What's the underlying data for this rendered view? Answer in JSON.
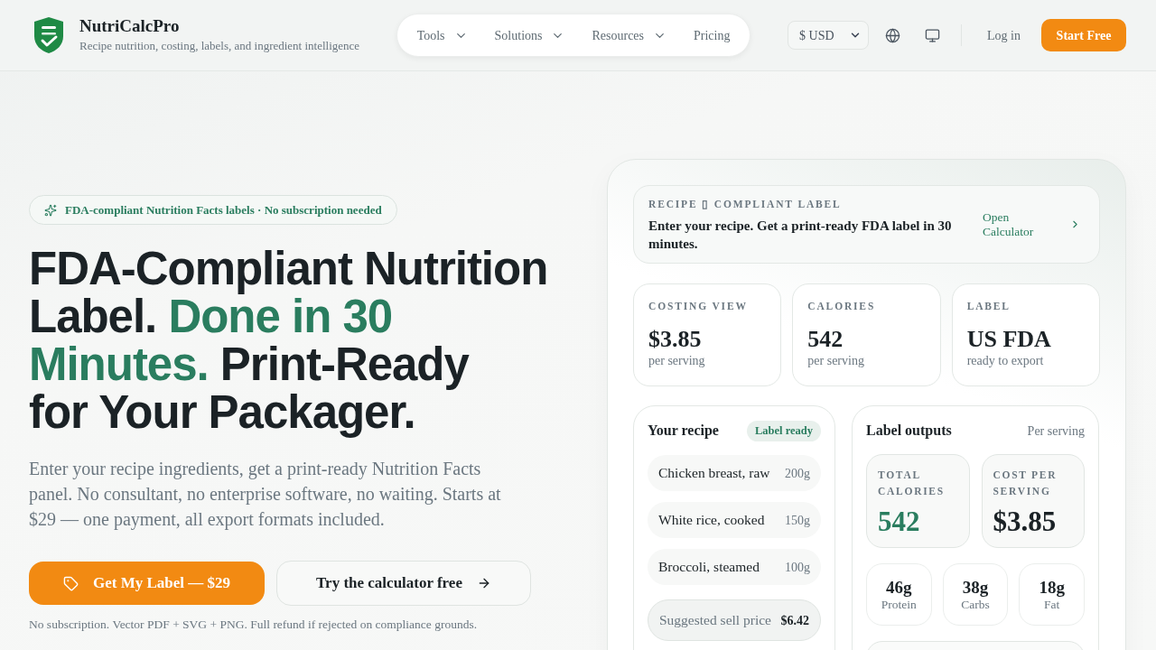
{
  "header": {
    "brand": {
      "name": "NutriCalcPro",
      "tagline": "Recipe nutrition, costing, labels, and ingredient intelligence"
    },
    "nav": [
      {
        "label": "Tools",
        "has_menu": true
      },
      {
        "label": "Solutions",
        "has_menu": true
      },
      {
        "label": "Resources",
        "has_menu": true
      },
      {
        "label": "Pricing",
        "has_menu": false
      }
    ],
    "currency": {
      "value": "$ USD"
    },
    "login": "Log in",
    "cta": "Start Free"
  },
  "hero": {
    "badge": "FDA-compliant Nutrition Facts labels · No subscription needed",
    "headline": [
      [
        {
          "text": "FDA-Compliant Nutrition",
          "accent": false
        }
      ],
      [
        {
          "text": "Label.",
          "accent": false
        },
        {
          "text": "Done in 30",
          "accent": true
        }
      ],
      [
        {
          "text": "Minutes.",
          "accent": true
        },
        {
          "text": "Print-Ready",
          "accent": false
        }
      ],
      [
        {
          "text": "for Your Packager.",
          "accent": false
        }
      ]
    ],
    "description": "Enter your recipe ingredients, get a print-ready Nutrition Facts panel. No consultant, no enterprise software, no waiting. Starts at $29 — one payment, all export formats included.",
    "buttons": [
      {
        "label": "Get My Label — $29",
        "kind": "primary"
      },
      {
        "label": "Try the calculator free",
        "kind": "secondary"
      }
    ],
    "note": "No subscription. Vector PDF + SVG + PNG. Full refund if rejected on compliance grounds."
  },
  "preview": {
    "intro": {
      "eyebrow": "RECIPE ▯ COMPLIANT LABEL",
      "text": "Enter your recipe. Get a print-ready FDA label in 30 minutes.",
      "link": "Open Calculator"
    },
    "stats": [
      {
        "label": "COSTING VIEW",
        "value": "$3.85",
        "caption": "per serving"
      },
      {
        "label": "CALORIES",
        "value": "542",
        "caption": "per serving"
      },
      {
        "label": "LABEL",
        "value": "US FDA",
        "caption": "ready to export"
      }
    ],
    "recipe": {
      "title": "Your recipe",
      "status": "Label ready",
      "ingredients": [
        {
          "name": "Chicken breast, raw",
          "amount": "200g"
        },
        {
          "name": "White rice, cooked",
          "amount": "150g"
        },
        {
          "name": "Broccoli, steamed",
          "amount": "100g"
        }
      ],
      "sell_price": {
        "label": "Suggested sell price",
        "value": "$6.42"
      }
    },
    "outputs": {
      "title": "Label outputs",
      "basis": "Per serving",
      "totals": [
        {
          "label": "TOTAL CALORIES",
          "value": "542",
          "accent": true
        },
        {
          "label": "COST PER SERVING",
          "value": "$3.85",
          "accent": false
        }
      ],
      "macros": [
        {
          "value": "46g",
          "label": "Protein"
        },
        {
          "value": "38g",
          "label": "Carbs"
        },
        {
          "value": "18g",
          "label": "Fat"
        }
      ]
    }
  }
}
